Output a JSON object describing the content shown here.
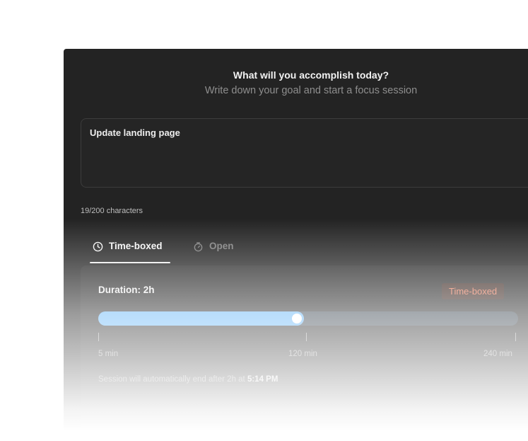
{
  "header": {
    "title": "What will you accomplish today?",
    "subtitle": "Write down your goal and start a focus session"
  },
  "goal": {
    "value": "Update landing page",
    "char_count": "19/200 characters"
  },
  "tabs": [
    {
      "label": "Time-boxed",
      "icon": "clock-icon",
      "active": true
    },
    {
      "label": "Open",
      "icon": "stopwatch-icon",
      "active": false
    }
  ],
  "session": {
    "duration_label": "Duration: 2h",
    "mode_badge": "Time-boxed",
    "slider": {
      "min": 5,
      "max": 240,
      "value": 120,
      "unit": "min"
    },
    "scale_labels": [
      "5 min",
      "120 min",
      "240 min"
    ],
    "info_prefix": "Session will automatically end after 2h at ",
    "info_time": "5:14 PM"
  },
  "colors": {
    "accent": "#66b6f7",
    "badge_text": "#e8795a",
    "panel_bg": "#232323"
  }
}
